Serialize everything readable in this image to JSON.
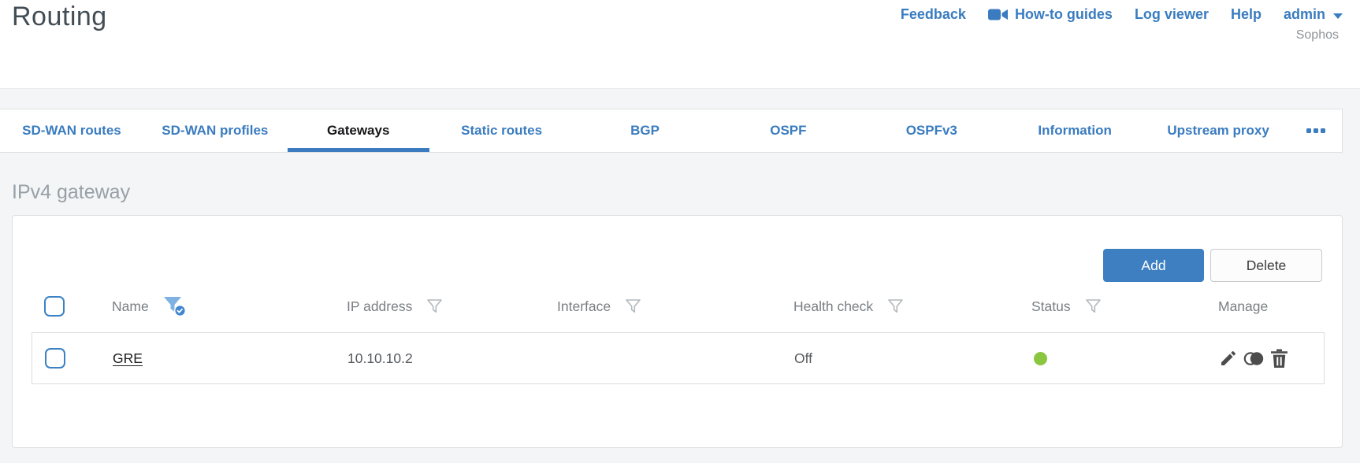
{
  "page": {
    "title": "Routing"
  },
  "header": {
    "links": [
      {
        "label": "Feedback"
      },
      {
        "label": "How-to guides",
        "icon": "video-camera-icon"
      },
      {
        "label": "Log viewer"
      },
      {
        "label": "Help"
      }
    ],
    "user_menu": {
      "label": "admin"
    },
    "brand": "Sophos"
  },
  "tabs": {
    "items": [
      {
        "label": "SD-WAN routes",
        "active": false
      },
      {
        "label": "SD-WAN profiles",
        "active": false
      },
      {
        "label": "Gateways",
        "active": true
      },
      {
        "label": "Static routes",
        "active": false
      },
      {
        "label": "BGP",
        "active": false
      },
      {
        "label": "OSPF",
        "active": false
      },
      {
        "label": "OSPFv3",
        "active": false
      },
      {
        "label": "Information",
        "active": false
      },
      {
        "label": "Upstream proxy",
        "active": false
      }
    ],
    "more": "more-tabs"
  },
  "section": {
    "heading": "IPv4 gateway"
  },
  "toolbar": {
    "add_label": "Add",
    "delete_label": "Delete"
  },
  "table": {
    "columns": [
      {
        "label": "Name",
        "filter": "active"
      },
      {
        "label": "IP address",
        "filter": "inactive"
      },
      {
        "label": "Interface",
        "filter": "inactive"
      },
      {
        "label": "Health check",
        "filter": "inactive"
      },
      {
        "label": "Status",
        "filter": "inactive"
      },
      {
        "label": "Manage",
        "filter": "none"
      }
    ],
    "rows": [
      {
        "name": "GRE",
        "ip_address": "10.10.10.2",
        "interface": "",
        "health_check": "Off",
        "status": "up",
        "actions": [
          "edit",
          "clone",
          "delete"
        ]
      }
    ]
  },
  "colors": {
    "accent": "#3a7cbf",
    "accent-btn": "#3d7fc1",
    "green": "#8ac640"
  }
}
